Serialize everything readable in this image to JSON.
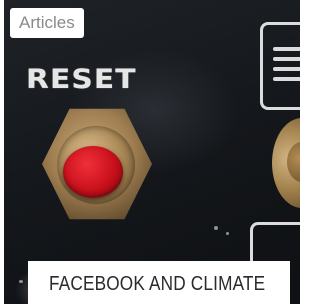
{
  "card": {
    "badge_label": "Articles",
    "title": "FACEBOOK AND CLIMATE"
  },
  "photo": {
    "panel_label": "RESET",
    "button_color": "#d0141e"
  }
}
